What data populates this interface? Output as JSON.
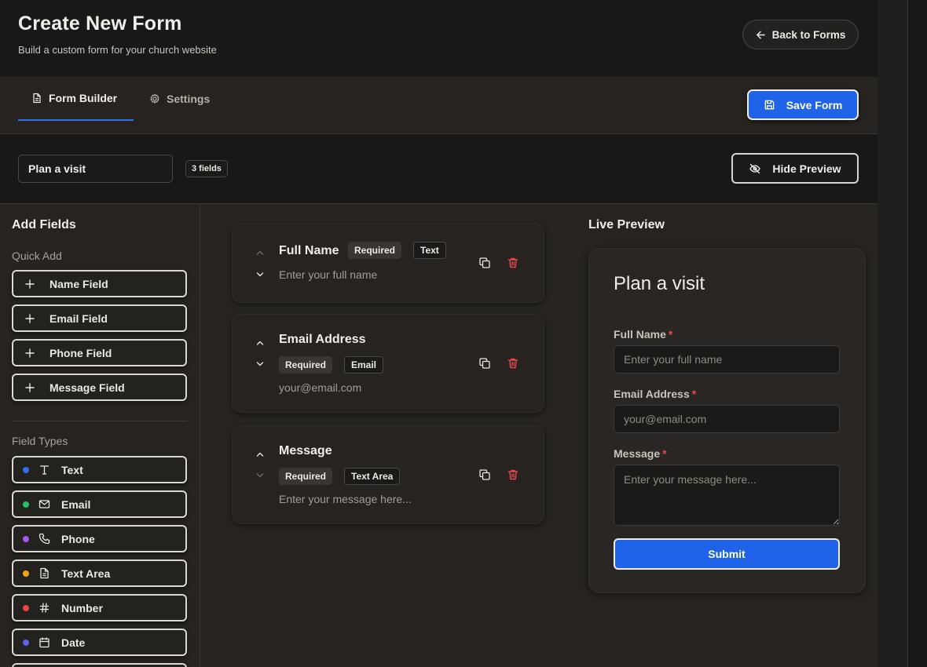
{
  "header": {
    "title": "Create New Form",
    "subtitle": "Build a custom form for your church website",
    "back_label": "Back to Forms"
  },
  "tabs": {
    "builder_label": "Form Builder",
    "settings_label": "Settings",
    "active": "Form Builder"
  },
  "save_label": "Save Form",
  "toolbar": {
    "form_name_value": "Plan a visit",
    "field_count": "3 fields",
    "hide_preview_label": "Hide Preview"
  },
  "sidebar": {
    "heading": "Add Fields",
    "quick_add_heading": "Quick Add",
    "quick_add": [
      {
        "label": "Name Field"
      },
      {
        "label": "Email Field"
      },
      {
        "label": "Phone Field"
      },
      {
        "label": "Message Field"
      }
    ],
    "field_types_heading": "Field Types",
    "field_types": [
      {
        "label": "Text",
        "color": "#2f6ff0",
        "icon": "text-icon"
      },
      {
        "label": "Email",
        "color": "#22c55e",
        "icon": "mail-icon"
      },
      {
        "label": "Phone",
        "color": "#a855f7",
        "icon": "phone-icon"
      },
      {
        "label": "Text Area",
        "color": "#f5a50b",
        "icon": "document-icon"
      },
      {
        "label": "Number",
        "color": "#ef4444",
        "icon": "hash-icon"
      },
      {
        "label": "Date",
        "color": "#5b62f0",
        "icon": "calendar-icon"
      }
    ]
  },
  "fields": [
    {
      "name": "Full Name",
      "required": "Required",
      "type": "Text",
      "placeholder": "Enter your full name"
    },
    {
      "name": "Email Address",
      "required": "Required",
      "type": "Email",
      "placeholder": "your@email.com"
    },
    {
      "name": "Message",
      "required": "Required",
      "type": "Text Area",
      "placeholder": "Enter your message here..."
    }
  ],
  "preview": {
    "heading": "Live Preview",
    "form_title": "Plan a visit",
    "required_marker": "*",
    "fields": [
      {
        "label": "Full Name",
        "placeholder": "Enter your full name"
      },
      {
        "label": "Email Address",
        "placeholder": "your@email.com"
      },
      {
        "label": "Message",
        "placeholder": "Enter your message here..."
      }
    ],
    "submit_label": "Submit"
  },
  "colors": {
    "accent": "#1f63e9",
    "danger": "#e5484d",
    "background": "#262320"
  }
}
